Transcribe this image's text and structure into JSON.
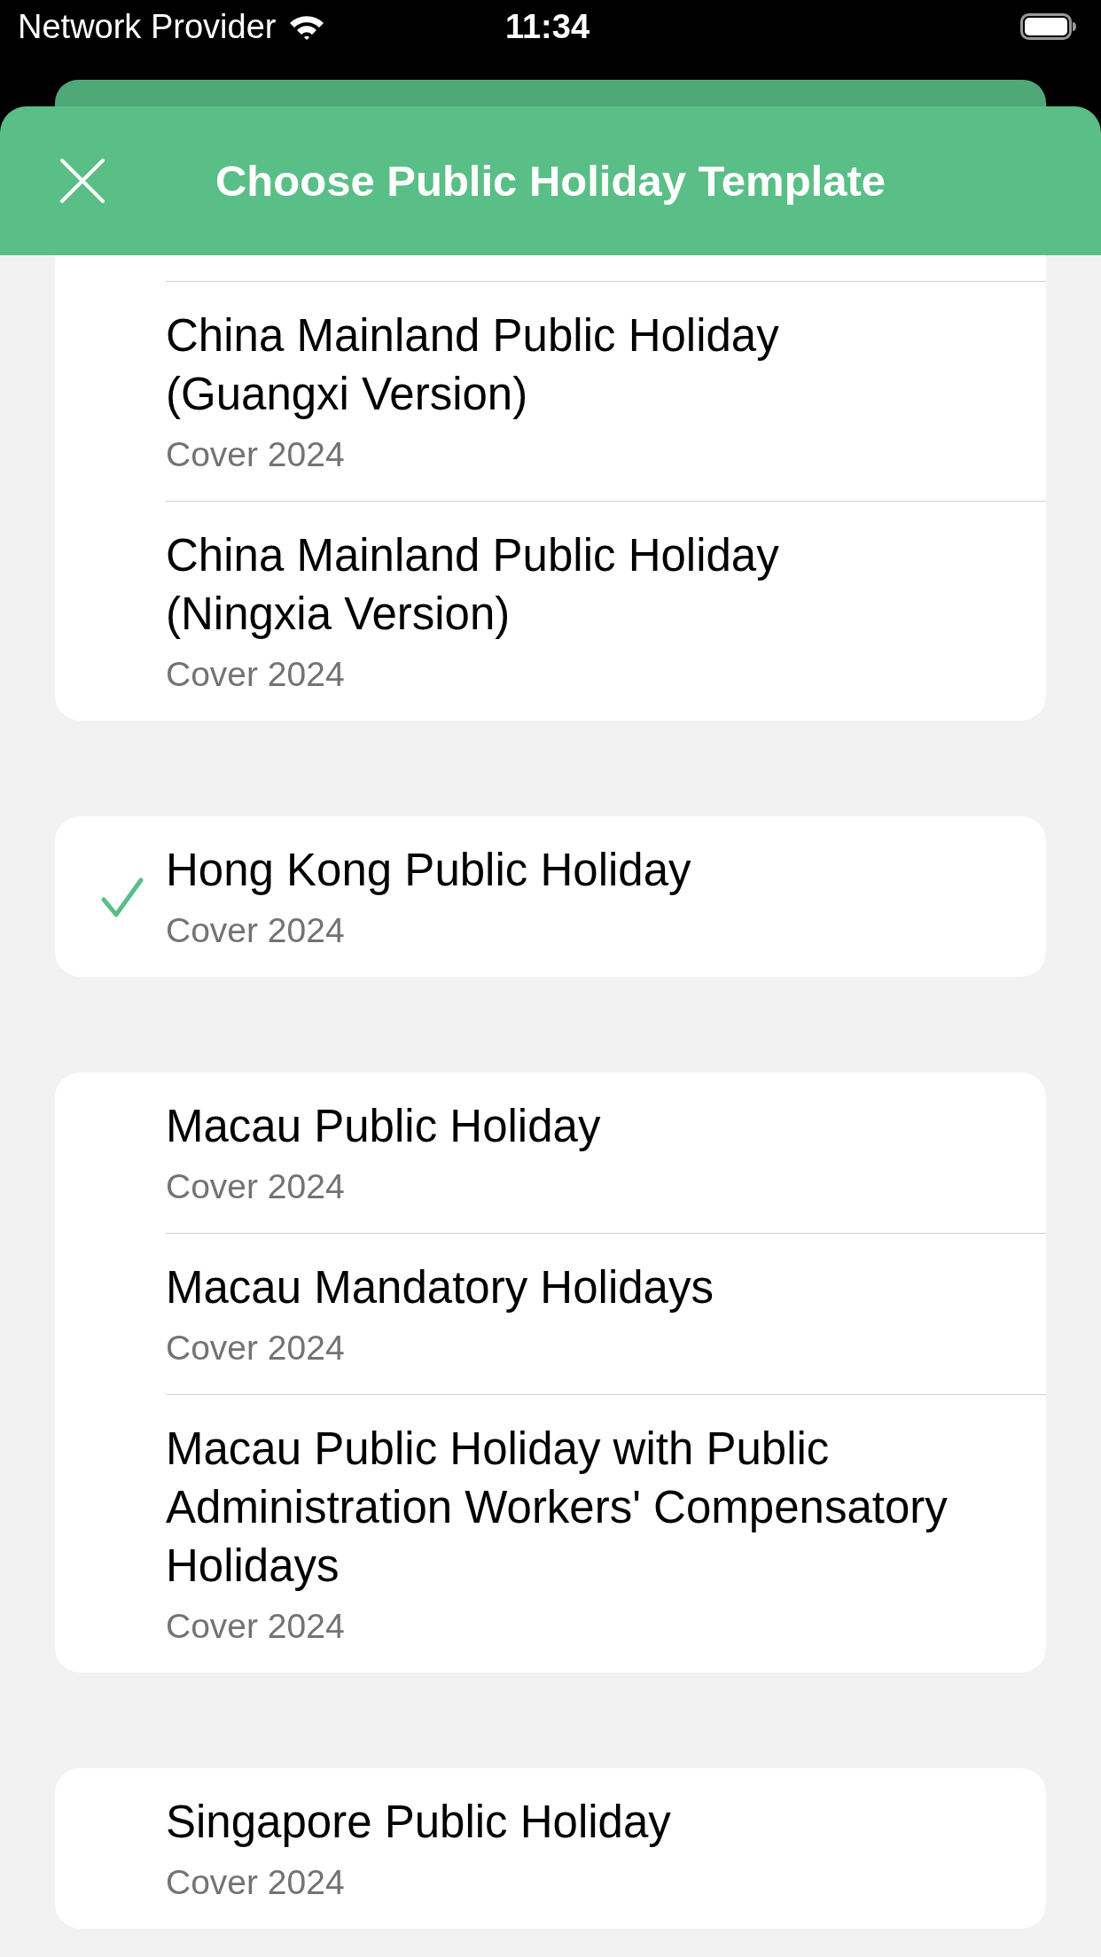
{
  "status_bar": {
    "carrier": "Network Provider",
    "time": "11:34"
  },
  "header": {
    "title": "Choose Public Holiday Template"
  },
  "sections": [
    {
      "items": [
        {
          "title": "China Mainland Public Holiday (Guangxi Version)",
          "subtitle": "Cover 2024",
          "selected": false
        },
        {
          "title": "China Mainland Public Holiday (Ningxia Version)",
          "subtitle": "Cover 2024",
          "selected": false
        }
      ]
    },
    {
      "items": [
        {
          "title": "Hong Kong Public Holiday",
          "subtitle": "Cover 2024",
          "selected": true
        }
      ]
    },
    {
      "items": [
        {
          "title": "Macau Public Holiday",
          "subtitle": "Cover 2024",
          "selected": false
        },
        {
          "title": "Macau Mandatory Holidays",
          "subtitle": "Cover 2024",
          "selected": false
        },
        {
          "title": "Macau Public Holiday with Public Administration Workers' Compensatory Holidays",
          "subtitle": "Cover 2024",
          "selected": false
        }
      ]
    },
    {
      "items": [
        {
          "title": "Singapore Public Holiday",
          "subtitle": "Cover 2024",
          "selected": false
        }
      ]
    }
  ]
}
